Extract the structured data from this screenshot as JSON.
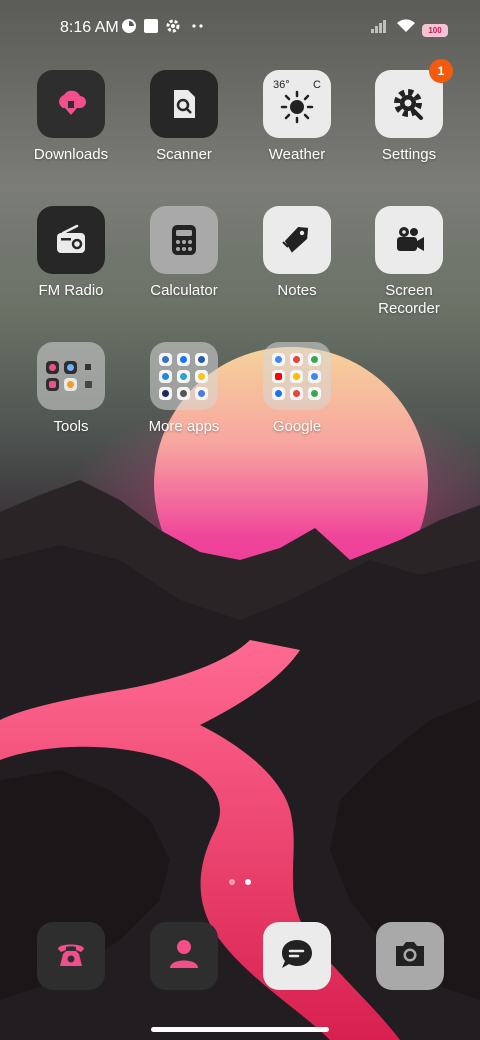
{
  "status_bar": {
    "time": "8:16 AM",
    "icons": [
      "data-saver-icon",
      "app-square-icon",
      "gear-icon",
      "more-dots-icon"
    ],
    "right_icons": [
      "signal-icon",
      "wifi-icon",
      "battery-icon"
    ],
    "battery_level": "100"
  },
  "apps": [
    {
      "label": "Downloads",
      "icon": "download-cloud-icon",
      "accent": "#f24f8c"
    },
    {
      "label": "Scanner",
      "icon": "scanner-icon"
    },
    {
      "label": "Weather",
      "icon": "weather-sun-icon",
      "temp": "36°",
      "unit": "C"
    },
    {
      "label": "Settings",
      "icon": "gear-wrench-icon",
      "badge": "1"
    },
    {
      "label": "FM Radio",
      "icon": "radio-icon"
    },
    {
      "label": "Calculator",
      "icon": "calculator-icon"
    },
    {
      "label": "Notes",
      "icon": "tag-icon"
    },
    {
      "label": "Screen Recorder",
      "icon": "video-camera-icon"
    },
    {
      "label": "Tools",
      "icon": "folder-icon"
    },
    {
      "label": "More apps",
      "icon": "folder-icon"
    },
    {
      "label": "Google",
      "icon": "folder-icon"
    }
  ],
  "pagination": {
    "pages": 2,
    "current": 2
  },
  "dock": [
    {
      "name": "phone",
      "icon": "phone-icon"
    },
    {
      "name": "contacts",
      "icon": "contact-person-icon"
    },
    {
      "name": "messages",
      "icon": "chat-bubble-icon"
    },
    {
      "name": "camera",
      "icon": "camera-icon"
    }
  ],
  "colors": {
    "accent_pink": "#f24f8c",
    "badge_orange": "#f25a0d",
    "sun_pink": "#f0449a",
    "river_pink": "#e52d63"
  }
}
